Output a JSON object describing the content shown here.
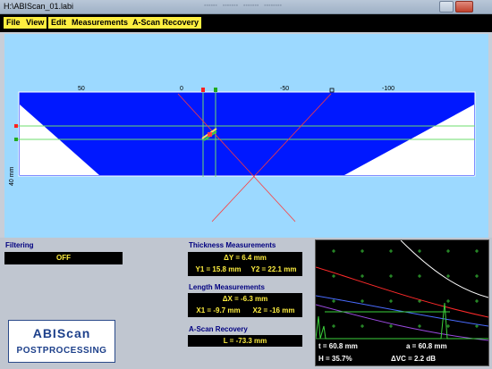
{
  "window": {
    "title": "H:\\ABIScan_01.labi"
  },
  "menu": [
    {
      "label": "File"
    },
    {
      "label": "View"
    },
    {
      "label": "Edit"
    },
    {
      "label": "Measurements"
    },
    {
      "label": "A-Scan Recovery"
    }
  ],
  "bscan": {
    "ticks": [
      "50",
      "0",
      "-50",
      "-100"
    ],
    "depth_label": "40 mm"
  },
  "filtering": {
    "label": "Filtering",
    "value": "OFF"
  },
  "thickness": {
    "label": "Thickness Measurements",
    "dy": "ΔY = 6.4 mm",
    "y1": "Y1 = 15.8 mm",
    "y2": "Y2 = 22.1 mm"
  },
  "length": {
    "label": "Length Measurements",
    "dx": "ΔX = -6.3 mm",
    "x1": "X1 = -9.7 mm",
    "x2": "X2 = -16 mm"
  },
  "ascan_recovery": {
    "label": "A-Scan Recovery",
    "value": "L = -73.3 mm"
  },
  "logo": {
    "line1": "ABIScan",
    "line2": "POSTPROCESSING"
  },
  "ascan": {
    "t": "t = 60.8 mm",
    "a": "a = 60.8 mm",
    "h": "H = 35.7%",
    "dvc": "ΔVC = 2.2 dB"
  },
  "colors": {
    "menu_bg": "#ffef40",
    "bscan_bg": "#9cd9ff",
    "bscan_blue": "#0018ff",
    "label_blue": "#000080",
    "readout_yellow": "#ffef40"
  }
}
